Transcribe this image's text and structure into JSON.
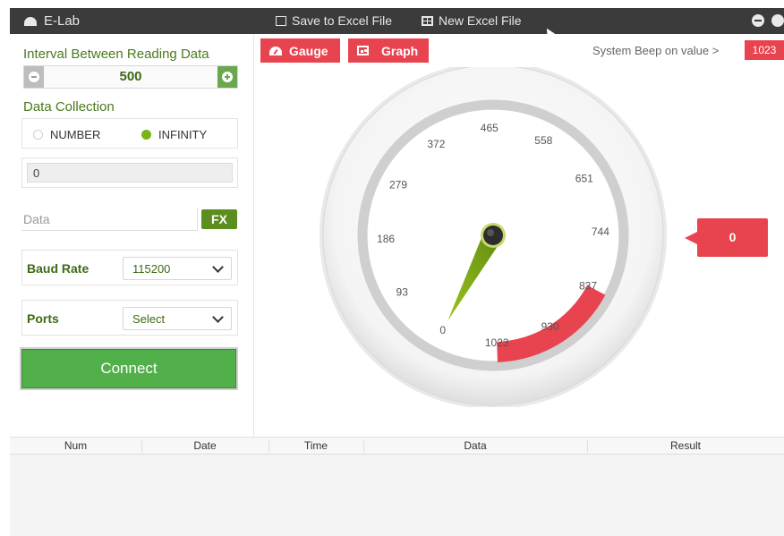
{
  "window": {
    "app_title": "E-Lab",
    "toolbar": {
      "save_label": "Save to Excel File",
      "new_label": "New Excel File"
    }
  },
  "left_panel": {
    "interval_label": "Interval Between Reading Data",
    "interval_value": "500",
    "collection_label": "Data Collection",
    "collection_options": [
      "NUMBER",
      "INFINITY"
    ],
    "collection_selected": "INFINITY",
    "readout_value": "0",
    "data_placeholder": "Data",
    "fx_label": "FX",
    "baud_label": "Baud Rate",
    "baud_value": "115200",
    "ports_label": "Ports",
    "ports_value": "Select",
    "connect_label": "Connect"
  },
  "right_panel": {
    "tabs": [
      "Gauge",
      "Graph"
    ],
    "beep_label": "System Beep on value >",
    "beep_value": "1023",
    "current_value": "0",
    "gauge": {
      "ticks": [
        "0",
        "93",
        "186",
        "279",
        "372",
        "465",
        "558",
        "651",
        "744",
        "837",
        "930",
        "1023"
      ],
      "min": 0,
      "max": 1023,
      "needle_value": 0,
      "alert_band": [
        837,
        1023
      ]
    }
  },
  "table": {
    "columns": [
      "Num",
      "Date",
      "Time",
      "Data",
      "Result"
    ]
  },
  "colors": {
    "accent_red": "#e8444f",
    "accent_green": "#52b04a",
    "needle_green": "#8fb31d",
    "titlebar": "#3b3b3b"
  }
}
